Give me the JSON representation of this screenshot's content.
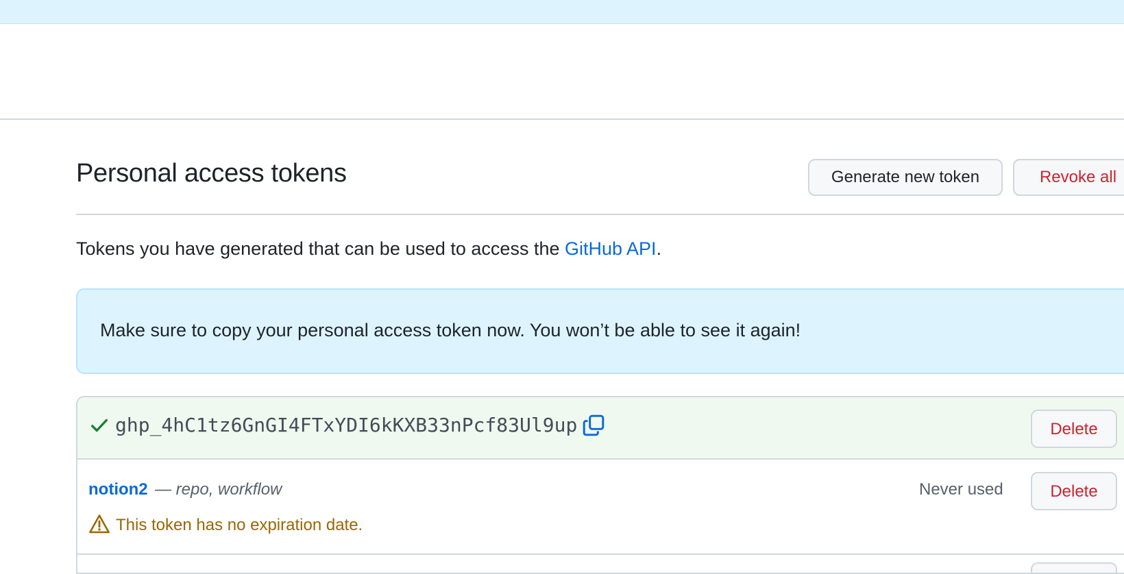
{
  "page": {
    "title": "Personal access tokens",
    "generate_button": "Generate new token",
    "revoke_all_button": "Revoke all",
    "intro_text": "Tokens you have generated that can be used to access the ",
    "intro_link": "GitHub API",
    "intro_suffix": "."
  },
  "flash": {
    "message": "Make sure to copy your personal access token now. You won’t be able to see it again!"
  },
  "new_token": {
    "value": "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",
    "delete_label": "Delete"
  },
  "tokens": [
    {
      "name": "notion2",
      "scopes": "— repo, workflow",
      "usage": "Never used",
      "delete_label": "Delete",
      "warning": "This token has no expiration date."
    }
  ],
  "colors": {
    "accent": "#0969da",
    "danger": "#cf222e",
    "warning": "#9a6700",
    "success": "#1a7f37",
    "info_bg": "#ddf4ff"
  },
  "icons": {
    "check": "check-icon",
    "copy": "copy-icon",
    "alert": "alert-icon"
  }
}
